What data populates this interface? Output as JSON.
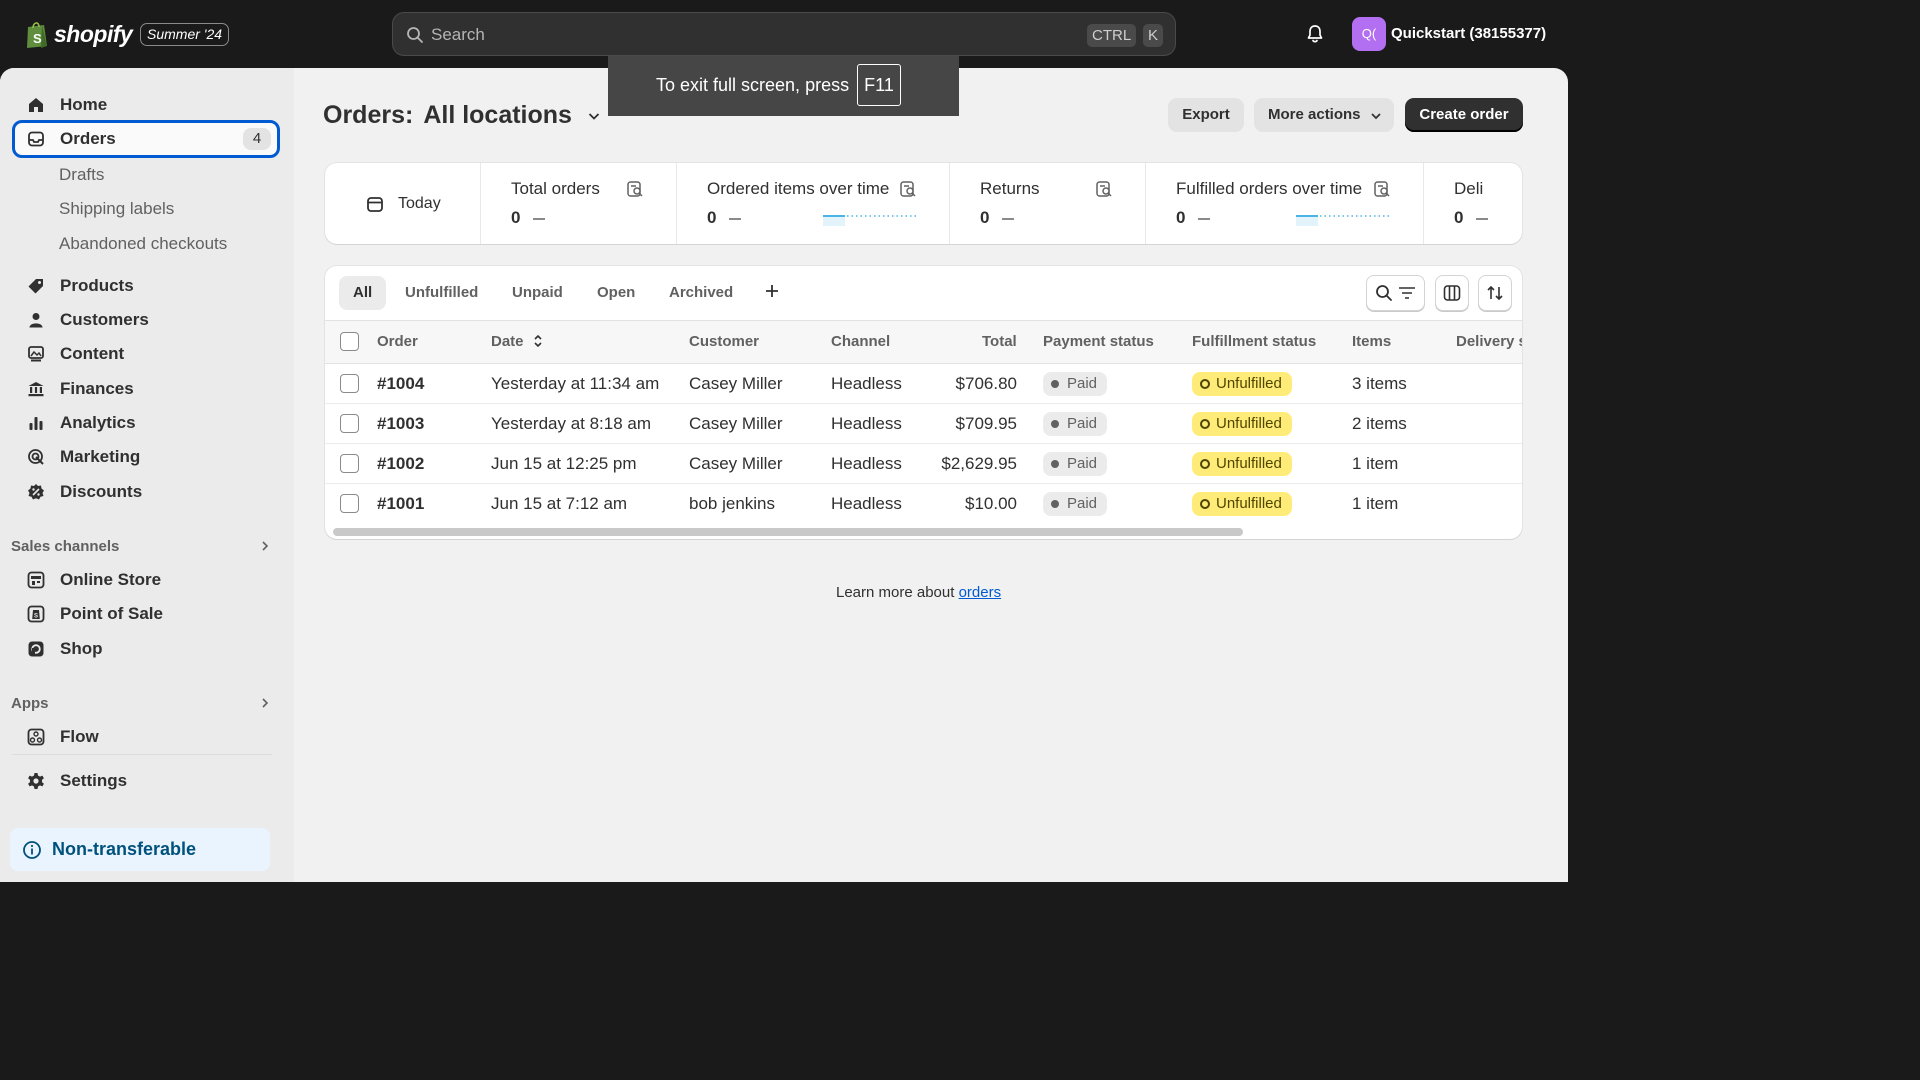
{
  "topbar": {
    "brand": "shopify",
    "edition": "Summer '24",
    "search_placeholder": "Search",
    "shortcut_ctrl": "CTRL",
    "shortcut_k": "K",
    "store_initials": "Q(",
    "store_name": "Quickstart (38155377)"
  },
  "toast": {
    "text": "To exit full screen, press",
    "key": "F11"
  },
  "sidebar": {
    "home": "Home",
    "orders": "Orders",
    "orders_count": "4",
    "orders_sub": [
      "Drafts",
      "Shipping labels",
      "Abandoned checkouts"
    ],
    "products": "Products",
    "customers": "Customers",
    "content": "Content",
    "finances": "Finances",
    "analytics": "Analytics",
    "marketing": "Marketing",
    "discounts": "Discounts",
    "sales_channels_heading": "Sales channels",
    "sales_channels": [
      "Online Store",
      "Point of Sale",
      "Shop"
    ],
    "apps_heading": "Apps",
    "apps": [
      "Flow"
    ],
    "settings": "Settings",
    "notice": "Non-transferable"
  },
  "page": {
    "title_prefix": "Orders:",
    "title_location": "All locations",
    "export": "Export",
    "more_actions": "More actions",
    "create_order": "Create order"
  },
  "metrics": {
    "date_range": "Today",
    "items": [
      {
        "label": "Total orders",
        "value": "0"
      },
      {
        "label": "Ordered items over time",
        "value": "0"
      },
      {
        "label": "Returns",
        "value": "0"
      },
      {
        "label": "Fulfilled orders over time",
        "value": "0"
      },
      {
        "label": "Deli",
        "value": "0"
      }
    ]
  },
  "table": {
    "tabs": [
      "All",
      "Unfulfilled",
      "Unpaid",
      "Open",
      "Archived"
    ],
    "headers": {
      "order": "Order",
      "date": "Date",
      "customer": "Customer",
      "channel": "Channel",
      "total": "Total",
      "payment": "Payment status",
      "fulfillment": "Fulfillment status",
      "items": "Items",
      "delivery": "Delivery s"
    },
    "rows": [
      {
        "order": "#1004",
        "date": "Yesterday at 11:34 am",
        "customer": "Casey Miller",
        "channel": "Headless",
        "total": "$706.80",
        "payment": "Paid",
        "fulfillment": "Unfulfilled",
        "items": "3 items"
      },
      {
        "order": "#1003",
        "date": "Yesterday at 8:18 am",
        "customer": "Casey Miller",
        "channel": "Headless",
        "total": "$709.95",
        "payment": "Paid",
        "fulfillment": "Unfulfilled",
        "items": "2 items"
      },
      {
        "order": "#1002",
        "date": "Jun 15 at 12:25 pm",
        "customer": "Casey Miller",
        "channel": "Headless",
        "total": "$2,629.95",
        "payment": "Paid",
        "fulfillment": "Unfulfilled",
        "items": "1 item"
      },
      {
        "order": "#1001",
        "date": "Jun 15 at 7:12 am",
        "customer": "bob jenkins",
        "channel": "Headless",
        "total": "$10.00",
        "payment": "Paid",
        "fulfillment": "Unfulfilled",
        "items": "1 item"
      }
    ]
  },
  "footer": {
    "learn_prefix": "Learn more about",
    "learn_link": "orders"
  },
  "colors": {
    "accent": "#005bd3",
    "topbar": "#1a1a1a",
    "avatar": "#b36ff1",
    "unfulfilled": "#ffeb78",
    "sparkline": "#4bb4e6"
  }
}
